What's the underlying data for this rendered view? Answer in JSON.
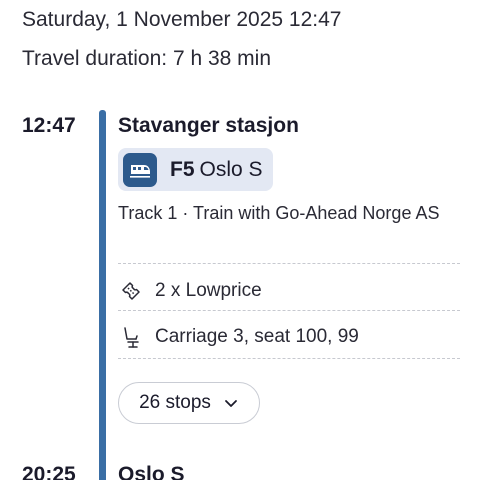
{
  "header": {
    "date_time": "Saturday, 1 November 2025 12:47",
    "duration": "Travel duration: 7 h 38 min"
  },
  "leg": {
    "departure_time": "12:47",
    "departure_station": "Stavanger stasjon",
    "line_code": "F5",
    "destination": "Oslo S",
    "track_info": "Track 1 · Train with Go-Ahead Norge AS",
    "ticket": "2 x Lowprice",
    "seat": "Carriage 3, seat 100, 99",
    "stops_label": "26 stops",
    "arrival_time": "20:25",
    "arrival_station": "Oslo S"
  },
  "icons": {
    "train": "train-icon",
    "ticket": "ticket-icon",
    "seat": "seat-icon",
    "chevron": "chevron-down-icon"
  },
  "colors": {
    "timeline": "#3a6ea5",
    "train_badge": "#2d5a8c",
    "chip_bg": "#e3e8f3"
  }
}
